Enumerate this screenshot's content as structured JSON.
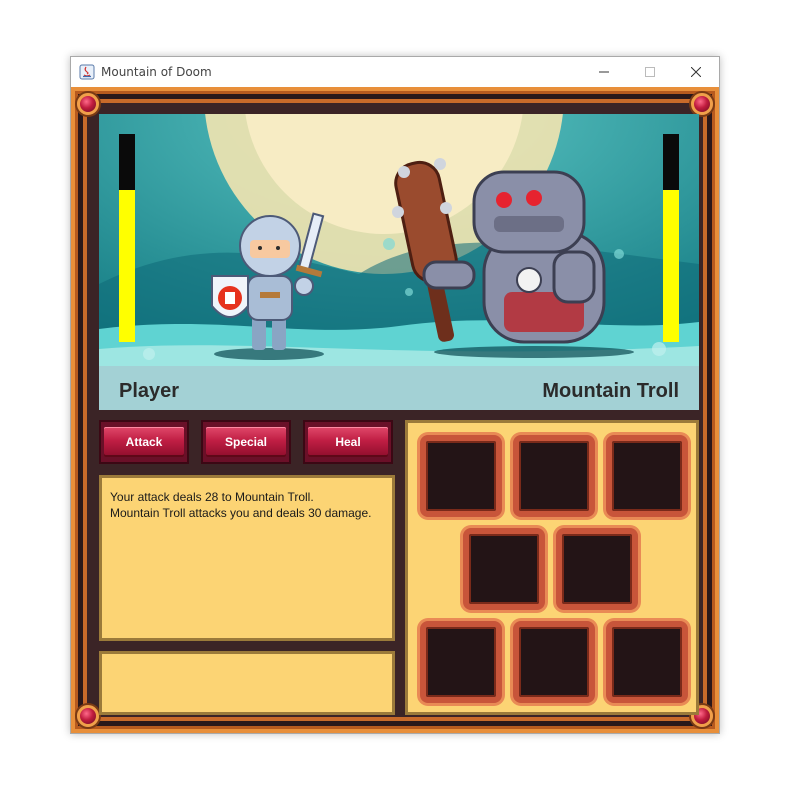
{
  "window": {
    "title": "Mountain of Doom"
  },
  "battle": {
    "player": {
      "name": "Player",
      "hp_fraction": 0.73
    },
    "enemy": {
      "name": "Mountain Troll",
      "hp_fraction": 0.73
    }
  },
  "actions": [
    {
      "label": "Attack"
    },
    {
      "label": "Special"
    },
    {
      "label": "Heal"
    }
  ],
  "log": {
    "lines": [
      "Your attack deals 28 to Mountain Troll.",
      "Mountain Troll attacks you and deals 30 damage."
    ]
  },
  "input": {
    "value": ""
  },
  "inventory": {
    "slots": 8
  },
  "colors": {
    "hp_fill": "#ffff00",
    "hp_empty": "#0a0a0a",
    "button": "#c01e44",
    "panel": "#fcd474",
    "frame": "#3b2426"
  }
}
